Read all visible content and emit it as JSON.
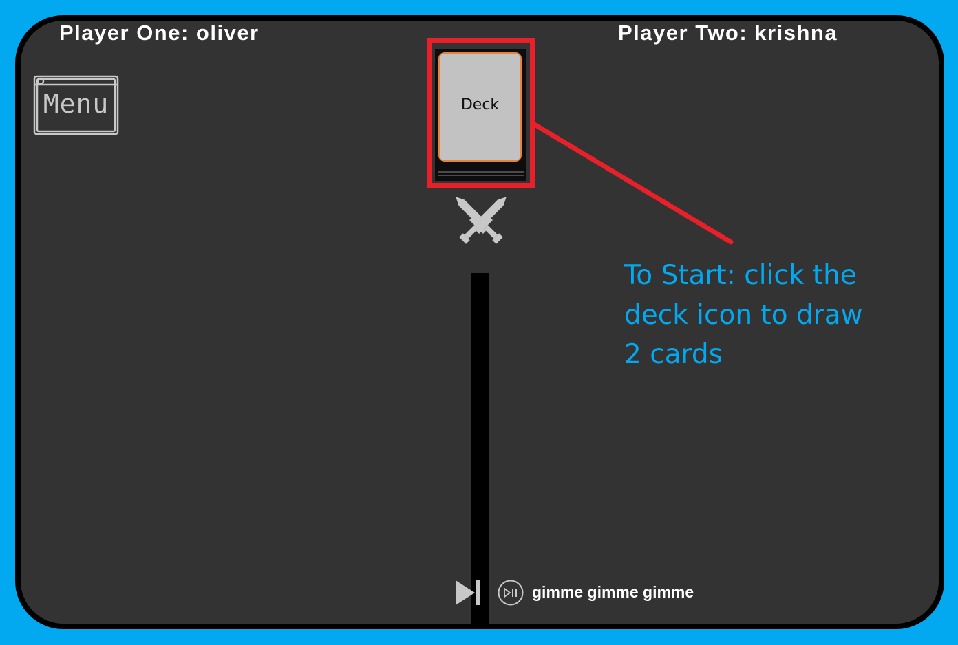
{
  "players": {
    "one_label": "Player One: oliver",
    "two_label": "Player Two: krishna"
  },
  "menu": {
    "label": "Menu",
    "icon": "menu-window-icon"
  },
  "deck": {
    "label": "Deck"
  },
  "battle_icon": "crossed-swords-icon",
  "annotation": {
    "lines": [
      "To Start: click the",
      "deck icon to draw",
      "2 cards"
    ],
    "color": "#03a9f0",
    "highlight_color": "#e8202a"
  },
  "music": {
    "skip_icon": "skip-next-icon",
    "play_pause_icon": "play-pause-icon",
    "song_title": "gimme gimme gimme"
  },
  "colors": {
    "frame": "#03a9f0",
    "board": "#333333",
    "text": "#ffffff",
    "icon_gray": "#c8c8c8"
  }
}
